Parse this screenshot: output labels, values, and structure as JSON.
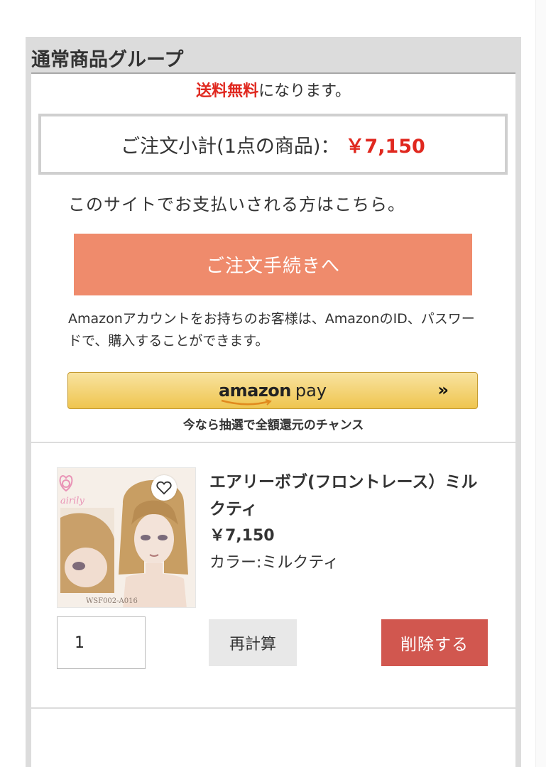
{
  "group": {
    "title": "通常商品グループ"
  },
  "shipping": {
    "highlight": "送料無料",
    "suffix": "になります。",
    "highlight_color": "#e0281f"
  },
  "subtotal": {
    "label": "ご注文小計(1点の商品)：",
    "amount": "￥7,150"
  },
  "payment": {
    "note": "このサイトでお支払いされる方はこちら。",
    "checkout_label": "ご注文手続きへ",
    "checkout_color": "#ef8b6c"
  },
  "amazon": {
    "note": "Amazonアカウントをお持ちのお客様は、AmazonのID、パスワードで、購入することができます。",
    "brand": "amazon",
    "pay": "pay",
    "arrows": "»",
    "campaign": "今なら抽選で全額還元のチャンス"
  },
  "item": {
    "name": "エアリーボブ(フロントレース）ミルクティ",
    "price": "￥7,150",
    "color": "カラー:ミルクティ",
    "image_logo": "airily",
    "image_code": "WSF002-A016",
    "quantity": "1",
    "recalc_label": "再計算",
    "delete_label": "削除する",
    "delete_color": "#d1574f",
    "icons": {
      "favorite": "heart-outline-icon"
    }
  }
}
